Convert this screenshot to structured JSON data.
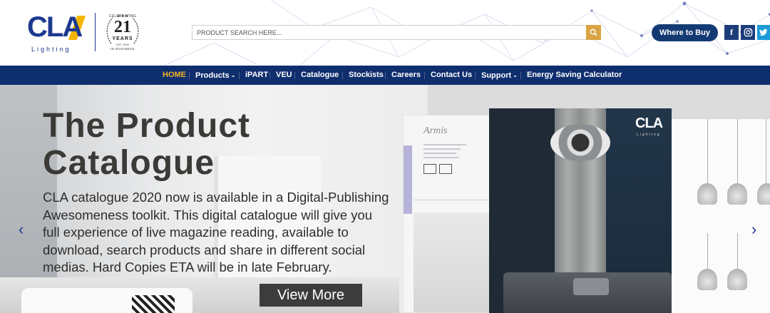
{
  "header": {
    "logo_text": "CLA",
    "logo_sub": "Lighting",
    "badge": {
      "top": "CELEBRATING",
      "number": "21",
      "years": "YEARS",
      "est": "EST 1999",
      "biz": "IN BUSINESS"
    },
    "search_placeholder": "PRODUCT SEARCH HERE...",
    "where_to_buy": "Where to Buy",
    "social": {
      "facebook": "f",
      "instagram": "ig",
      "twitter": "t"
    }
  },
  "nav": [
    {
      "label": "HOME",
      "active": true
    },
    {
      "label": "Products",
      "dropdown": true
    },
    {
      "label": "iPART"
    },
    {
      "label": "VEU"
    },
    {
      "label": "Catalogue"
    },
    {
      "label": "Stockists"
    },
    {
      "label": "Careers"
    },
    {
      "label": "Contact Us"
    },
    {
      "label": "Support",
      "dropdown": true
    },
    {
      "label": "Energy Saving Calculator"
    }
  ],
  "hero": {
    "title_line1": "The Product",
    "title_line2": "Catalogue",
    "description": "CLA catalogue 2020 now is available in a Digital-Publishing Awesomeness toolkit. This digital catalogue will give you full experience of live magazine reading, available to download, search products and share in different social medias. Hard Copies ETA will be in late February.",
    "button": "View More",
    "page_name": "Armis",
    "cover_brand": "CLA",
    "cover_brand_sub": "Lighting"
  },
  "colors": {
    "brand_blue": "#0f2e6e",
    "accent_gold": "#f3b32a",
    "search_button": "#d9a441"
  }
}
